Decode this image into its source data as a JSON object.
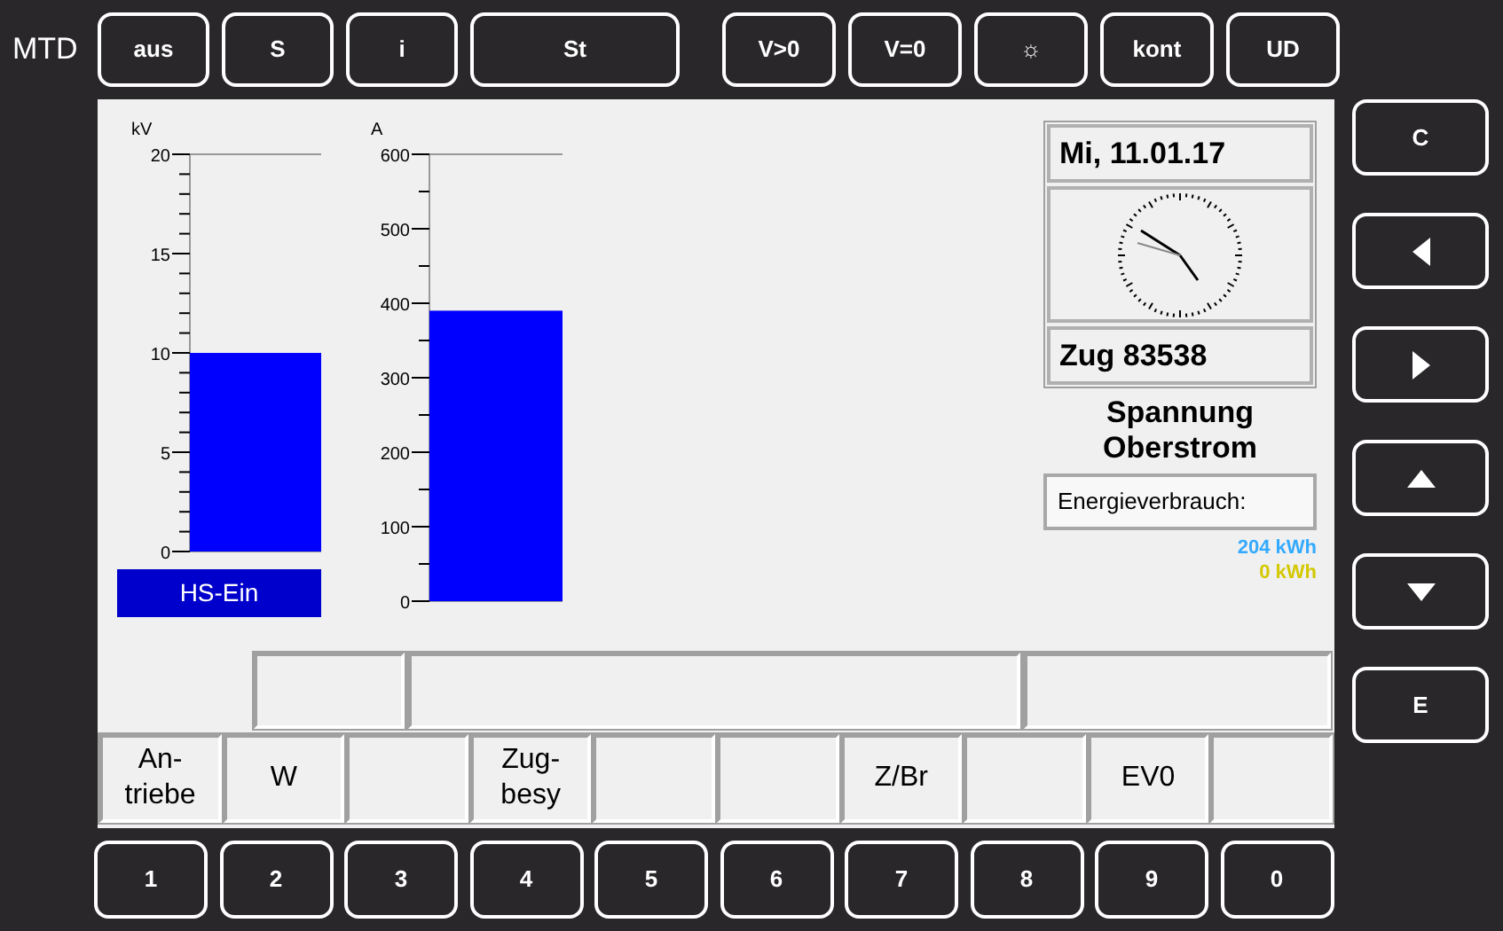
{
  "header": "MTD",
  "top_buttons": [
    {
      "label": "aus"
    },
    {
      "label": "S"
    },
    {
      "label": "i"
    },
    {
      "label": "St"
    }
  ],
  "top_buttons_right": [
    {
      "label": "V>0"
    },
    {
      "label": "V=0"
    },
    {
      "label": "☼"
    },
    {
      "label": "kont"
    },
    {
      "label": "UD"
    }
  ],
  "gauges": [
    {
      "chart_data": {
        "type": "bar",
        "ylabel": "kV",
        "values": [
          10
        ],
        "ylim": [
          0,
          20
        ],
        "yticks": [
          0,
          5,
          10,
          15,
          20
        ]
      },
      "status": "HS-Ein"
    },
    {
      "chart_data": {
        "type": "bar",
        "ylabel": "A",
        "values": [
          390
        ],
        "ylim": [
          0,
          600
        ],
        "yticks": [
          0,
          100,
          200,
          300,
          400,
          500,
          600
        ]
      }
    }
  ],
  "date": "Mi, 11.01.17",
  "train": "Zug 83538",
  "mode_lines": [
    "Spannung",
    "Oberstrom"
  ],
  "energy_label": "Energieverbrauch:",
  "energy_values": [
    {
      "text": "204 kWh",
      "color": "#33aaff"
    },
    {
      "text": "0 kWh",
      "color": "#d4c800"
    }
  ],
  "soft_keys": [
    {
      "kind": "label",
      "lines": [
        "An-",
        "triebe"
      ]
    },
    {
      "kind": "label",
      "lines": [
        "W"
      ]
    },
    {
      "kind": "blank"
    },
    {
      "kind": "label",
      "lines": [
        "Zug-",
        "besy"
      ]
    },
    {
      "kind": "blank"
    },
    {
      "kind": "blank"
    },
    {
      "kind": "label",
      "lines": [
        "Z/Br"
      ]
    },
    {
      "kind": "blank"
    },
    {
      "kind": "label",
      "lines": [
        "EV0"
      ]
    },
    {
      "kind": "blank"
    }
  ],
  "number_keys": [
    "1",
    "2",
    "3",
    "4",
    "5",
    "6",
    "7",
    "8",
    "9",
    "0"
  ],
  "side_buttons": [
    {
      "kind": "label",
      "label": "C"
    },
    {
      "kind": "left"
    },
    {
      "kind": "right"
    },
    {
      "kind": "up"
    },
    {
      "kind": "down"
    },
    {
      "kind": "label",
      "label": "E"
    }
  ]
}
